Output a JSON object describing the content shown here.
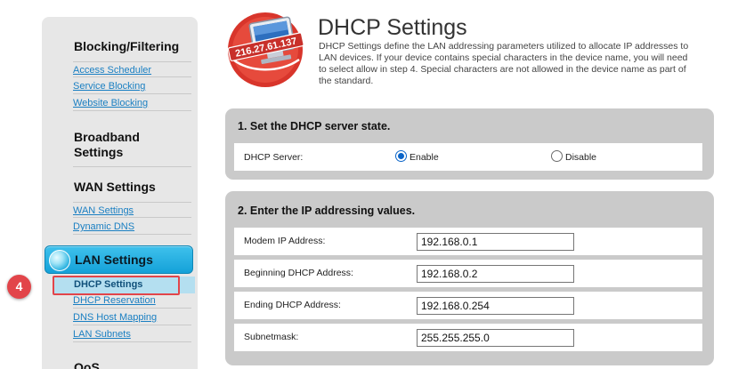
{
  "sidebar": {
    "blocking_heading": "Blocking/Filtering",
    "blocking_links": [
      "Access Scheduler",
      "Service Blocking",
      "Website Blocking"
    ],
    "broadband_heading": "Broadband\nSettings",
    "wan_heading": "WAN Settings",
    "wan_links": [
      "WAN Settings",
      "Dynamic DNS"
    ],
    "lan_heading": "LAN Settings",
    "lan_active_link": "DHCP Settings",
    "lan_links": [
      "DHCP Reservation",
      "DNS Host Mapping",
      "LAN Subnets"
    ],
    "qos_heading": "QoS",
    "step_badge": "4"
  },
  "header": {
    "logo_text": "216.27.61.137",
    "title": "DHCP Settings",
    "description": "DHCP Settings define the LAN addressing parameters utilized to allocate IP addresses to LAN devices. If your device contains special characters in the device name, you will need to select allow in step 4. Special characters are not allowed in the device name as part of the standard."
  },
  "section1": {
    "title": "1. Set the DHCP server state.",
    "label": "DHCP Server:",
    "options": [
      "Enable",
      "Disable"
    ],
    "selected": "Enable"
  },
  "section2": {
    "title": "2. Enter the IP addressing values.",
    "fields": [
      {
        "label": "Modem IP Address:",
        "value": "192.168.0.1"
      },
      {
        "label": "Beginning DHCP Address:",
        "value": "192.168.0.2"
      },
      {
        "label": "Ending DHCP Address:",
        "value": "192.168.0.254"
      },
      {
        "label": "Subnetmask:",
        "value": "255.255.255.0"
      }
    ]
  },
  "colors": {
    "link": "#1a7fc2",
    "accent": "#14a1d8",
    "highlight": "#e2454a",
    "section_bg": "#cacaca"
  }
}
